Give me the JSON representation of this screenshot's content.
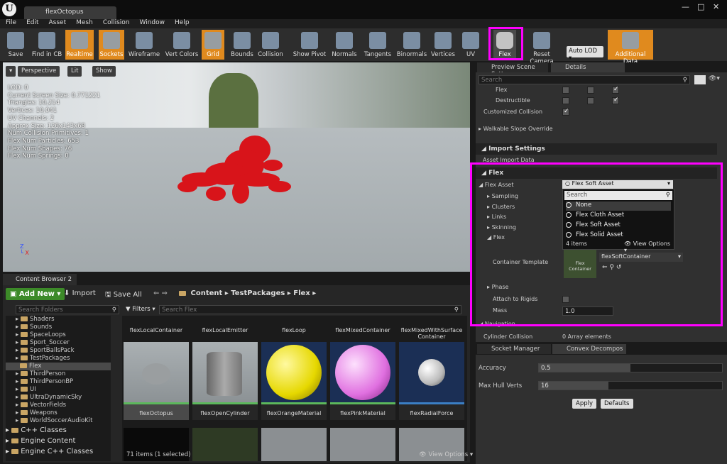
{
  "window": {
    "tab_title": "flexOctopus",
    "logo": "U"
  },
  "menu": [
    "File",
    "Edit",
    "Asset",
    "Mesh",
    "Collision",
    "Window",
    "Help"
  ],
  "toolbar": {
    "buttons": [
      {
        "label": "Save",
        "icon": "save-icon"
      },
      {
        "label": "Find in CB",
        "icon": "search-icon"
      },
      {
        "label": "Realtime",
        "icon": "stopwatch-icon"
      },
      {
        "label": "Sockets",
        "icon": "sockets-icon"
      },
      {
        "label": "Wireframe",
        "icon": "wireframe-icon"
      },
      {
        "label": "Vert Colors",
        "icon": "paintbrush-icon"
      },
      {
        "label": "Grid",
        "icon": "grid-icon"
      },
      {
        "label": "Bounds",
        "icon": "bounds-icon"
      },
      {
        "label": "Collision",
        "icon": "collision-icon"
      },
      {
        "label": "Show Pivot",
        "icon": "pivot-icon"
      },
      {
        "label": "Normals",
        "icon": "normals-icon"
      },
      {
        "label": "Tangents",
        "icon": "tangents-icon"
      },
      {
        "label": "Binormals",
        "icon": "binormals-icon"
      },
      {
        "label": "Vertices",
        "icon": "vertices-icon"
      },
      {
        "label": "UV",
        "icon": "uv-icon"
      },
      {
        "label": "Flex",
        "icon": "flex-icon"
      },
      {
        "label": "Reset Camera",
        "icon": "camera-icon"
      },
      {
        "label": "Additional Data",
        "icon": "additional-data-icon"
      }
    ],
    "lod_select": "Auto LOD"
  },
  "viewport": {
    "perspective": "Perspective",
    "lit": "Lit",
    "show": "Show",
    "stats": [
      "LOD: 0",
      "Current Screen Size:  0.771221",
      "Triangles:  10,214",
      "Vertices:  10,041",
      "UV Channels:  2",
      "Approx Size: 126x143x68",
      "Num Collision Primitives:  1",
      "Flex Num Particles: 653",
      "Flex Num Shapes: 76",
      "Flex Num Springs: 0"
    ]
  },
  "content_browser": {
    "tab": "Content Browser 2",
    "add_new": "Add New",
    "import": "Import",
    "save_all": "Save All",
    "path": [
      "Content",
      "TestPackages",
      "Flex"
    ],
    "search_folders": "Search Folders",
    "filters": "Filters",
    "search_flex": "Search Flex",
    "folders": [
      "Shaders",
      "Sounds",
      "SpaceLoops",
      "Sport_Soccer",
      "SportBallsPack",
      "TestPackages",
      "Flex",
      "ThirdPerson",
      "ThirdPersonBP",
      "UI",
      "UltraDynamicSky",
      "VectorFields",
      "Weapons",
      "WorldSoccerAudioKit"
    ],
    "classes": [
      "C++ Classes",
      "Engine Content",
      "Engine C++ Classes"
    ],
    "top_row": [
      "flexLocalContainer",
      "flexLocalEmitter",
      "flexLoop",
      "flexMixedContainer",
      "flexMixedWithSurface Container"
    ],
    "tiles": [
      "flexOctopus",
      "flexOpenCylinder",
      "flexOrangeMaterial",
      "flexPinkMaterial",
      "flexRadialForce"
    ],
    "status": "71 items (1 selected)",
    "view_options": "View Options"
  },
  "right_tabs": [
    "Preview Scene Sett",
    "Details"
  ],
  "details": {
    "search_placeholder": "Search",
    "rows_top": [
      "Flex",
      "Destructible",
      "Customized Collision",
      "Walkable Slope Override"
    ],
    "import_settings": "Import Settings",
    "asset_import_data": "Asset Import Data",
    "flex_section": "Flex",
    "flex_asset_label": "Flex Asset",
    "flex_asset_value": "Flex Soft Asset",
    "subrows": [
      "Sampling",
      "Clusters",
      "Links",
      "Skinning",
      "Flex"
    ],
    "dropdown": {
      "search": "Search",
      "options": [
        "None",
        "Flex Cloth Asset",
        "Flex Soft Asset",
        "Flex Solid Asset"
      ],
      "count": "4 items",
      "view_options": "View Options"
    },
    "container_template_label": "Container Template",
    "container_thumb": "Flex Container",
    "container_value": "flexSoftContainer",
    "phase": "Phase",
    "attach_to_rigids": "Attach to Rigids",
    "mass_label": "Mass",
    "mass_value": "1.0",
    "navigation": "Navigation",
    "cylinder_collision": "Cylinder Collision",
    "array_elements": "0 Array elements"
  },
  "bottom_tabs": [
    "Socket Manager",
    "Convex Decompos"
  ],
  "convex": {
    "accuracy_label": "Accuracy",
    "accuracy_value": "0.5",
    "accuracy_fill": 0.5,
    "hull_label": "Max Hull Verts",
    "hull_value": "16",
    "hull_fill": 0.38,
    "apply": "Apply",
    "defaults": "Defaults"
  },
  "colors": {
    "accent_orange": "#e08a1e",
    "highlight": "#ff00ff",
    "green": "#3c8a28"
  }
}
